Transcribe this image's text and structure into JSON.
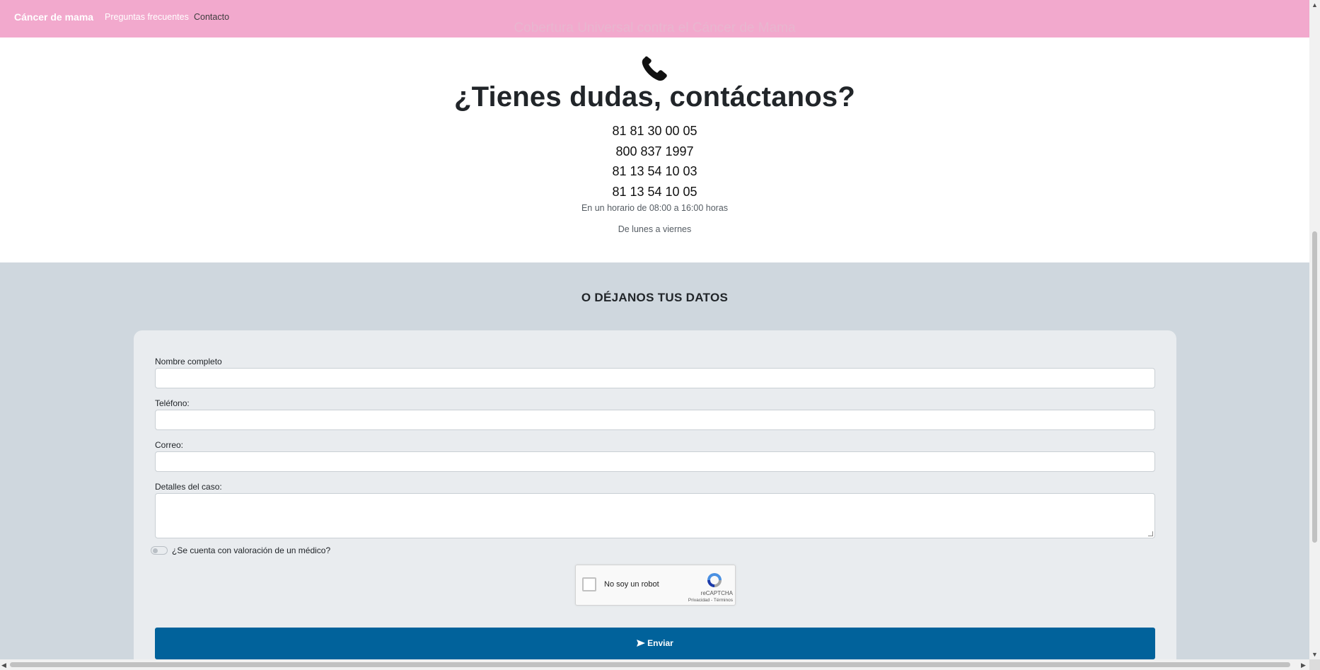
{
  "navbar": {
    "brand": "Cáncer de mama",
    "links": [
      "Preguntas frecuentes",
      "Contacto"
    ],
    "subtitle": "Cobertura Universal contra el Cáncer de Mama",
    "color": "#f2a9cd"
  },
  "contact": {
    "icon": "phone-icon",
    "heading": "¿Tienes dudas, contáctanos?",
    "phones": [
      "81 81 30 00 05",
      "800 837 1997",
      "81 13 54 10 03",
      "81 13 54 10 05"
    ],
    "schedule": "En un horario de 08:00 a 16:00 horas",
    "days": "De lunes a viernes"
  },
  "form": {
    "heading": "O DÉJANOS TUS DATOS",
    "fields": {
      "name_label": "Nombre completo",
      "name_value": "",
      "phone_label": "Teléfono:",
      "phone_value": "",
      "email_label": "Correo:",
      "email_value": "",
      "details_label": "Detalles del caso:",
      "details_value": ""
    },
    "toggle_label": "¿Se cuenta con valoración de un médico?",
    "toggle_on": false,
    "captcha": {
      "text": "No soy un robot",
      "brand": "reCAPTCHA",
      "links": "Privacidad - Términos"
    },
    "submit_label": "Enviar",
    "submit_icon": "send-icon",
    "submit_color": "#01629b"
  },
  "scrollbar": {
    "up_arrow": "▲",
    "down_arrow": "▼",
    "left_arrow": "◀",
    "right_arrow": "▶"
  }
}
